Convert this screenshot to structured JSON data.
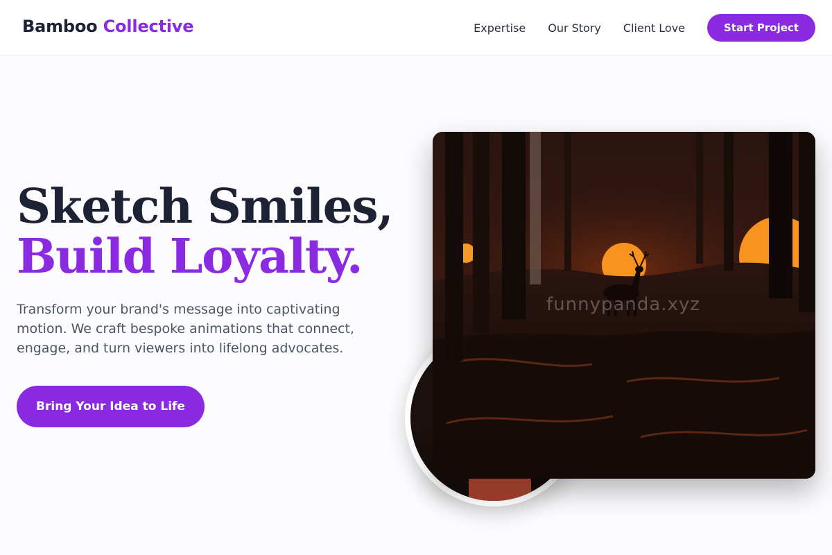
{
  "header": {
    "brand_part1": "Bamboo",
    "brand_part2": "Collective",
    "nav": [
      "Expertise",
      "Our Story",
      "Client Love"
    ],
    "cta_label": "Start Project"
  },
  "hero": {
    "title_line1": "Sketch Smiles,",
    "title_line2": "Build Loyalty.",
    "description": "Transform your brand's message into captivating motion. We craft bespoke animations that connect, engage, and turn viewers into lifelong advocates.",
    "cta_label": "Bring Your Idea to Life"
  },
  "media": {
    "watermark": "funnypanda.xyz",
    "main_image": "forest-deer-sunset-illustration",
    "secondary_image": "circular-character-thumbnail"
  },
  "colors": {
    "accent": "#8a2be2",
    "heading": "#1e2235",
    "body_text": "#4b5563",
    "background": "#fcfbfd"
  }
}
